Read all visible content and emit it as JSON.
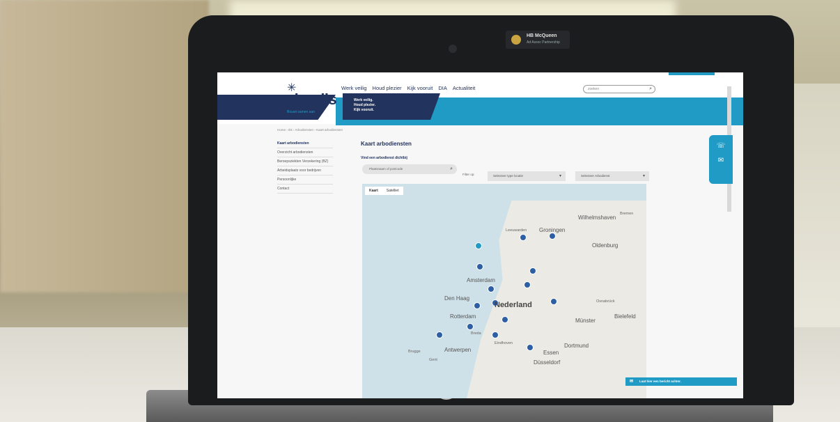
{
  "sticker": {
    "line1": "HB McQueen",
    "line2": "Ad Assoc Partnership"
  },
  "laptop": {
    "brand": "hp"
  },
  "site": {
    "logo_text": "volandis",
    "logo_sub": "Bouwt samen aan",
    "tagline": [
      "Werk veilig.",
      "Houd plezier.",
      "Kijk vooruit."
    ],
    "nav": [
      "Werk veilig",
      "Houd plezier",
      "Kijk vooruit",
      "DIA",
      "Actualiteit"
    ],
    "search_placeholder": "zoeken",
    "breadcrumb": "Home › Ikk › Arbodiensten › Kaart arbodiensten"
  },
  "sidebar": {
    "items": [
      {
        "label": "Kaart arbodiensten",
        "active": true
      },
      {
        "label": "Overzicht arbodiensten",
        "active": false
      },
      {
        "label": "Beroepsziekten Verzekering (BZ)",
        "active": false
      },
      {
        "label": "Arbeidsplaats voor bedrijven",
        "active": false
      },
      {
        "label": "Persoonlijke",
        "active": false
      },
      {
        "label": "Contact",
        "active": false
      }
    ]
  },
  "main": {
    "title": "Kaart arbodiensten",
    "find_label": "Vind een arbodienst dichtbij",
    "place_placeholder": "Plaatsnaam of postcode",
    "filter_label": "Filter op:",
    "type_select": "Selecteer type locatie",
    "arbo_select": "Selecteer Arbodienst"
  },
  "map": {
    "tabs": [
      "Kaart",
      "Satelliet"
    ],
    "active_tab": "Kaart",
    "labels": [
      {
        "text": "Wilhelmshaven",
        "size": "mid"
      },
      {
        "text": "Bremen",
        "size": "sm"
      },
      {
        "text": "Groningen",
        "size": "mid"
      },
      {
        "text": "Leeuwarden",
        "size": "sm"
      },
      {
        "text": "Oldenburg",
        "size": "mid"
      },
      {
        "text": "Amsterdam",
        "size": "mid"
      },
      {
        "text": "Den Haag",
        "size": "mid"
      },
      {
        "text": "Nederland",
        "size": "big"
      },
      {
        "text": "Osnabrück",
        "size": "sm"
      },
      {
        "text": "Rotterdam",
        "size": "mid"
      },
      {
        "text": "Münster",
        "size": "mid"
      },
      {
        "text": "Bielefeld",
        "size": "mid"
      },
      {
        "text": "Breda",
        "size": "sm"
      },
      {
        "text": "Eindhoven",
        "size": "sm"
      },
      {
        "text": "Dortmund",
        "size": "mid"
      },
      {
        "text": "Antwerpen",
        "size": "mid"
      },
      {
        "text": "Essen",
        "size": "mid"
      },
      {
        "text": "Düsseldorf",
        "size": "mid"
      },
      {
        "text": "Gent",
        "size": "sm"
      },
      {
        "text": "Brugge",
        "size": "sm"
      }
    ]
  },
  "cookie_bar": {
    "text": "Laat hier een bericht achter."
  }
}
